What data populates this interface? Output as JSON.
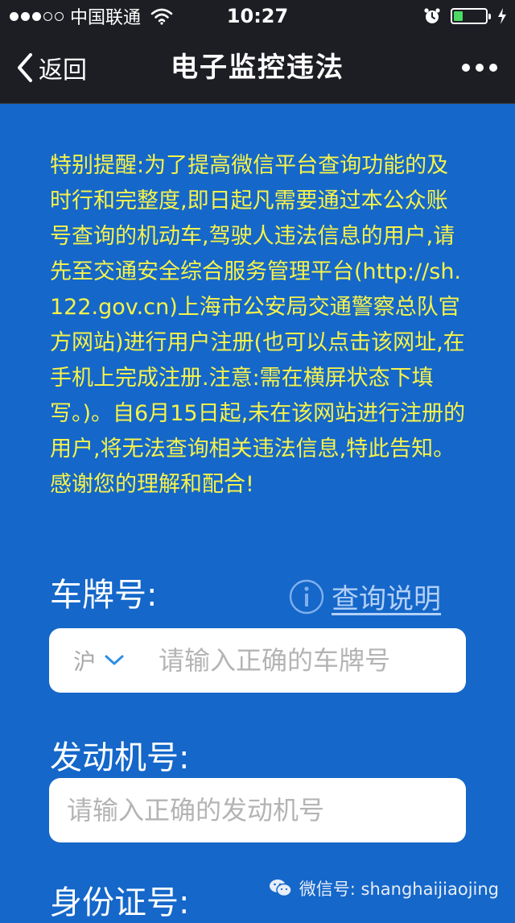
{
  "status_bar": {
    "carrier": "中国联通",
    "time": "10:27",
    "signal_bars_filled": 3,
    "signal_bars_total": 5,
    "battery_level": 0.3,
    "icons": [
      "wifi-icon",
      "alarm-icon",
      "battery-icon",
      "charging-icon"
    ]
  },
  "nav": {
    "back_label": "返回",
    "title": "电子监控违法",
    "icons": [
      "chevron-left-icon",
      "more-icon"
    ]
  },
  "notice": {
    "text": "特别提醒:为了提高微信平台查询功能的及时行和完整度,即日起凡需要通过本公众账号查询的机动车,驾驶人违法信息的用户,请先至交通安全综合服务管理平台(http://sh.122.gov.cn)上海市公安局交通警察总队官方网站)进行用户注册(也可以点击该网址,在手机上完成注册.注意:需在横屏状态下填写。)。自6月15日起,未在该网站进行注册的用户,将无法查询相关违法信息,特此告知。感谢您的理解和配合!"
  },
  "form": {
    "plate_label": "车牌号:",
    "help_label": "查询说明",
    "province_value": "沪",
    "plate_placeholder": "请输入正确的车牌号",
    "engine_label": "发动机号:",
    "engine_placeholder": "请输入正确的发动机号",
    "id_label": "身份证号:"
  },
  "watermark": {
    "text": "微信号: shanghaijiaojing"
  },
  "colors": {
    "background": "#1567c9",
    "bar": "#1d1e24",
    "notice_text": "#f6f34b",
    "link": "#b3d0f7",
    "battery": "#4cd964"
  }
}
